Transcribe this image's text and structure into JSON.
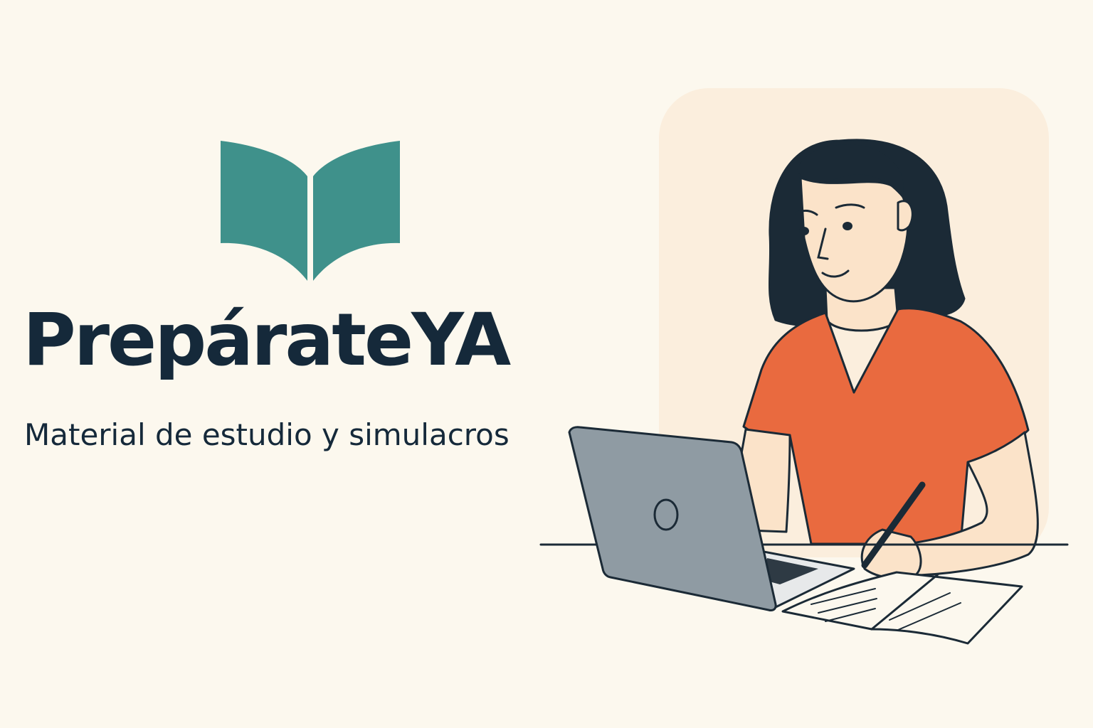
{
  "brand": {
    "name": "PrepárateYA",
    "tagline": "Material de estudio y simulacros",
    "logo_icon": "open-book-icon"
  },
  "illustration": {
    "subject": "student-studying-icon"
  },
  "colors": {
    "background": "#fcf8ee",
    "panel": "#fbeedd",
    "text": "#15293a",
    "book_teal": "#3f918b",
    "shirt": "#e96a3f",
    "laptop": "#8f9ba3",
    "skin": "#fbe3c9"
  }
}
